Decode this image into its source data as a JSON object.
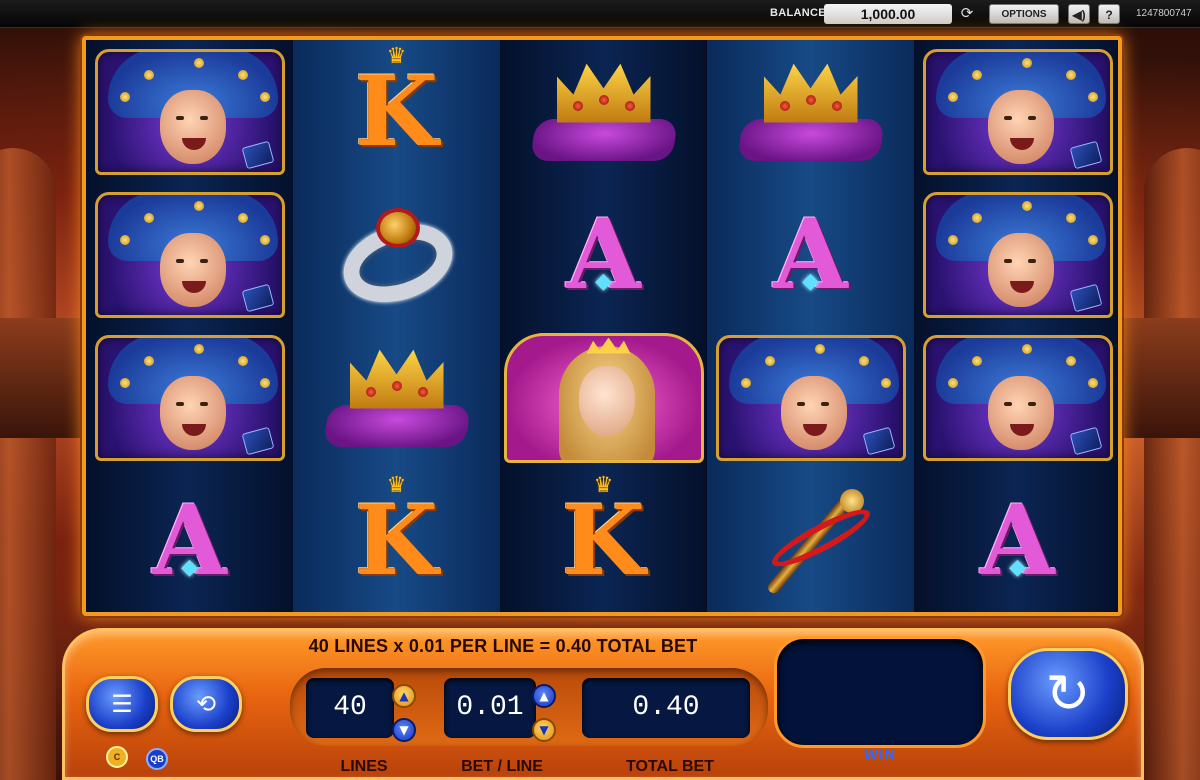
{
  "topbar": {
    "balance_label": "BALANCE",
    "balance_value": "1,000.00",
    "options_label": "OPTIONS",
    "help_label": "?",
    "session_id": "1247800747"
  },
  "reels": [
    [
      "jester",
      "jester",
      "jester",
      "A"
    ],
    [
      "K",
      "ring",
      "crown-pillow",
      "K"
    ],
    [
      "crown-pillow",
      "A",
      "princess",
      "K"
    ],
    [
      "crown-pillow",
      "A",
      "jester",
      "scepter"
    ],
    [
      "jester",
      "jester",
      "jester",
      "A"
    ]
  ],
  "panel": {
    "bet_summary": "40 LINES x 0.01 PER LINE = 0.40 TOTAL BET",
    "lines_value": "40",
    "bet_value": "0.01",
    "total_value": "0.40",
    "lines_label": "LINES",
    "bet_label": "BET / LINE",
    "total_label": "TOTAL BET",
    "win_label": "WIN",
    "badge_c": "C",
    "badge_qb": "QB"
  },
  "icons": {
    "refresh": "refresh-icon",
    "sound": "speaker-icon",
    "menu": "paytable-icon",
    "autoplay": "autoplay-icon",
    "spin": "spin-icon"
  },
  "colors": {
    "frame": "#f29a1e",
    "panel": "#e86410",
    "display": "#061842",
    "button_blue": "#1a3ec8"
  }
}
